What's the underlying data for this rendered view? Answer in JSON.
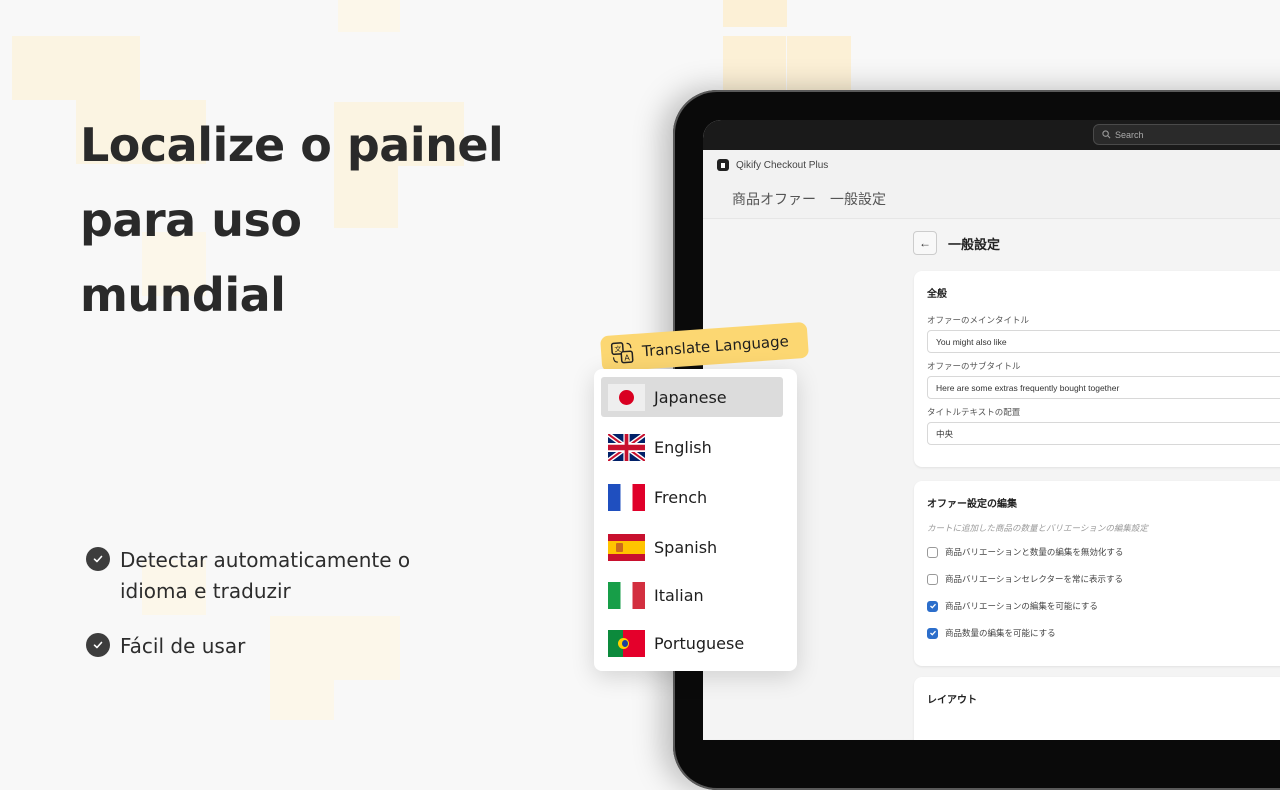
{
  "hero": {
    "title_lines": [
      "Localize o painel",
      "para uso",
      "mundial"
    ],
    "features": [
      "Detectar automaticamente o idioma e traduzir",
      "Fácil de usar"
    ]
  },
  "app": {
    "search_placeholder": "Search",
    "app_name": "Qikify Checkout Plus",
    "page_title": "商品オファー　一般設定",
    "sub_title": "一般設定",
    "back_icon": "←",
    "general_card": {
      "heading": "全般",
      "fields": [
        {
          "label": "オファーのメインタイトル",
          "value": "You might also like"
        },
        {
          "label": "オファーのサブタイトル",
          "value": "Here are some extras frequently bought together"
        },
        {
          "label": "タイトルテキストの配置",
          "value": "中央"
        }
      ]
    },
    "edit_card": {
      "heading": "オファー設定の編集",
      "hint": "カートに追加した商品の数量とバリエーションの編集設定",
      "checkboxes": [
        {
          "label": "商品バリエーションと数量の編集を無効化する",
          "checked": false
        },
        {
          "label": "商品バリエーションセレクターを常に表示する",
          "checked": false
        },
        {
          "label": "商品バリエーションの編集を可能にする",
          "checked": true
        },
        {
          "label": "商品数量の編集を可能にする",
          "checked": true
        }
      ]
    },
    "layout_card": {
      "heading": "レイアウト"
    }
  },
  "language_menu": {
    "tag_label": "Translate Language",
    "selected": "Japanese",
    "items": [
      {
        "label": "Japanese",
        "flag": "jp"
      },
      {
        "label": "English",
        "flag": "gb"
      },
      {
        "label": "French",
        "flag": "fr"
      },
      {
        "label": "Spanish",
        "flag": "es"
      },
      {
        "label": "Italian",
        "flag": "it"
      },
      {
        "label": "Portuguese",
        "flag": "pt"
      }
    ]
  },
  "colors": {
    "accent_yellow": "#fcd772",
    "checkbox_blue": "#2c6ecb",
    "headline": "#2a2a2a"
  }
}
